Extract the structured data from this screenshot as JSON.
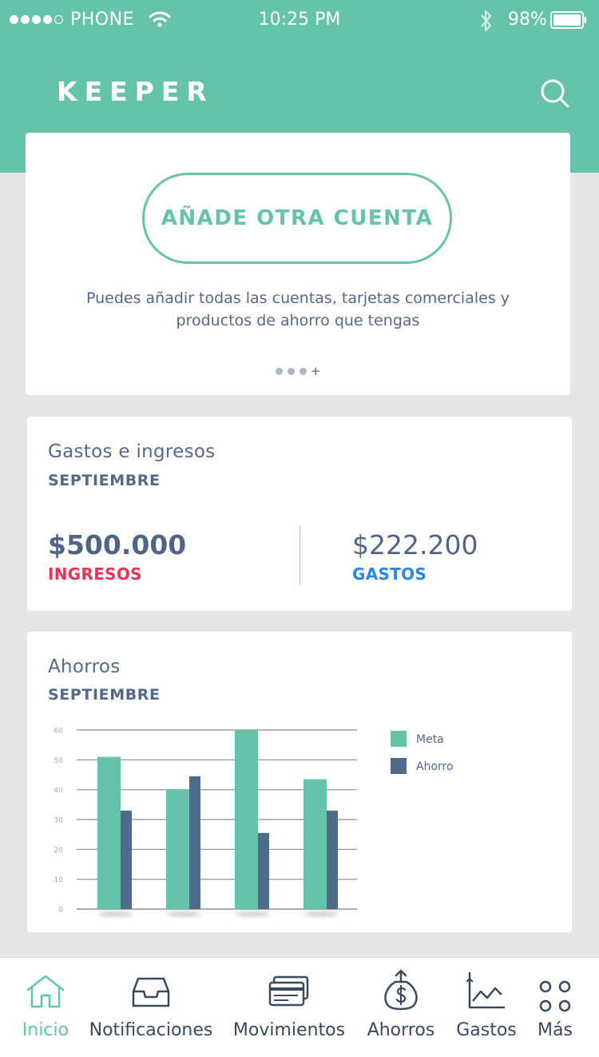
{
  "colors": {
    "accent": "#65c3aa",
    "text": "#4f6583",
    "income": "#ee3156",
    "expense": "#2a86e6",
    "series_meta": "#65c3aa",
    "series_ahorro": "#4f6b8c",
    "background": "#e6e6e6"
  },
  "status_bar": {
    "carrier": "PHONE",
    "time": "10:25 PM",
    "battery": "98%",
    "signal_icon": "signal-dots-icon",
    "wifi_icon": "wifi-icon",
    "bluetooth_icon": "bluetooth-icon",
    "battery_icon": "battery-icon"
  },
  "header": {
    "title": "KEEPER",
    "search_icon": "search-icon"
  },
  "accounts_card": {
    "button_label": "AÑADE OTRA CUENTA",
    "description": "Puedes añadir todas las cuentas, tarjetas comerciales y productos de ahorro que tengas",
    "pager_plus": "+"
  },
  "flow_card": {
    "title": "Gastos e ingresos",
    "month": "SEPTIEMBRE",
    "income_amount": "$500.000",
    "income_label": "INGRESOS",
    "expense_amount": "$222.200",
    "expense_label": "GASTOS"
  },
  "savings_card": {
    "title": "Ahorros",
    "month": "SEPTIEMBRE"
  },
  "chart_data": {
    "type": "bar",
    "categories": [
      "",
      "",
      "",
      ""
    ],
    "series": [
      {
        "name": "Meta",
        "values": [
          51,
          40,
          60,
          43.5
        ]
      },
      {
        "name": "Ahorro",
        "values": [
          33,
          44.5,
          25.5,
          33
        ]
      }
    ],
    "yticks": [
      0,
      10,
      20,
      30,
      40,
      50,
      60
    ],
    "ylim": [
      0,
      60
    ],
    "grid": true,
    "legend": "right",
    "title": "",
    "xlabel": "",
    "ylabel": ""
  },
  "tabs": [
    {
      "label": "Inicio",
      "icon": "home-icon",
      "active": true
    },
    {
      "label": "Notificaciones",
      "icon": "inbox-icon",
      "active": false
    },
    {
      "label": "Movimientos",
      "icon": "cards-icon",
      "active": false
    },
    {
      "label": "Ahorros",
      "icon": "money-bag-icon",
      "active": false
    },
    {
      "label": "Gastos",
      "icon": "line-chart-icon",
      "active": false
    },
    {
      "label": "Más",
      "icon": "more-dots-icon",
      "active": false
    }
  ]
}
